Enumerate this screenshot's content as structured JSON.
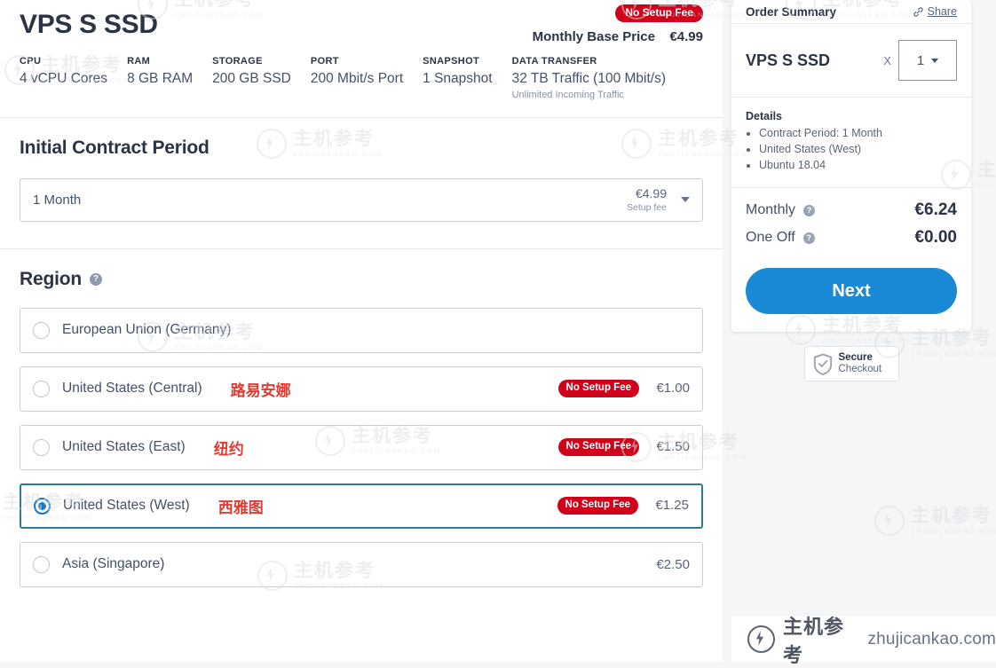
{
  "product": {
    "title": "VPS S SSD",
    "no_setup_fee_badge": "No Setup Fee",
    "base_price_label": "Monthly Base Price",
    "base_price_value": "€4.99",
    "specs": [
      {
        "label": "CPU",
        "value": "4 vCPU Cores",
        "sub": ""
      },
      {
        "label": "RAM",
        "value": "8 GB RAM",
        "sub": ""
      },
      {
        "label": "STORAGE",
        "value": "200 GB SSD",
        "sub": ""
      },
      {
        "label": "PORT",
        "value": "200 Mbit/s Port",
        "sub": ""
      },
      {
        "label": "SNAPSHOT",
        "value": "1 Snapshot",
        "sub": ""
      },
      {
        "label": "DATA TRANSFER",
        "value": "32 TB Traffic (100 Mbit/s)",
        "sub": "Unlimited Incoming Traffic"
      }
    ]
  },
  "contract": {
    "section_title": "Initial Contract Period",
    "selected": "1 Month",
    "fee_amount": "€4.99",
    "fee_sub": "Setup fee"
  },
  "region": {
    "section_title": "Region",
    "help_icon": "help-icon",
    "options": [
      {
        "name": "European Union (Germany)",
        "annotation": "",
        "badge": "",
        "price": "",
        "selected": false
      },
      {
        "name": "United States (Central)",
        "annotation": "路易安娜",
        "badge": "No Setup Fee",
        "price": "€1.00",
        "selected": false
      },
      {
        "name": "United States (East)",
        "annotation": "纽约",
        "badge": "No Setup Fee",
        "price": "€1.50",
        "selected": false
      },
      {
        "name": "United States (West)",
        "annotation": "西雅图",
        "badge": "No Setup Fee",
        "price": "€1.25",
        "selected": true
      },
      {
        "name": "Asia (Singapore)",
        "annotation": "",
        "badge": "",
        "price": "€2.50",
        "selected": false
      }
    ]
  },
  "sidebar": {
    "summary_title": "Order Summary",
    "share_label": "Share",
    "share_icon": "link-icon",
    "item_name": "VPS S SSD",
    "qty_x": "X",
    "qty_value": "1",
    "details_title": "Details",
    "details": [
      "Contract Period: 1 Month",
      "United States (West)",
      "Ubuntu 18.04"
    ],
    "totals": [
      {
        "label": "Monthly",
        "value": "€6.24"
      },
      {
        "label": "One Off",
        "value": "€0.00"
      }
    ],
    "next_label": "Next",
    "secure_line1": "Secure",
    "secure_line2": "Checkout"
  },
  "watermark": {
    "cn": "主机参考",
    "en": "ZHUJICANKAO.COM"
  },
  "brand_bar": {
    "cn": "主机参考",
    "domain": "zhujicankao.com"
  },
  "colors": {
    "accent_blue": "#1a8ad6",
    "danger_red": "#d0021b",
    "selected_border": "#2a7b99",
    "annotation_red": "#e23b32"
  }
}
